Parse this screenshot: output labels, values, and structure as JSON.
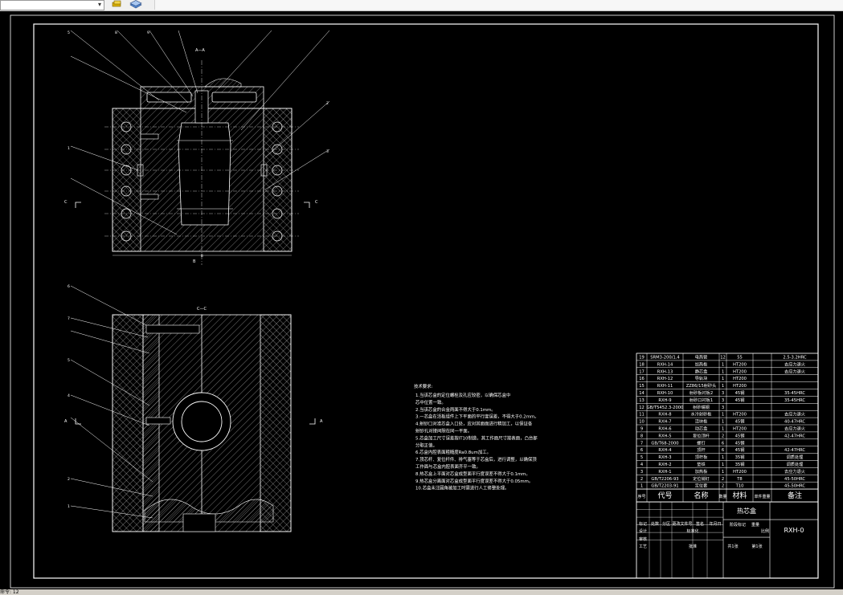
{
  "toolbar": {
    "combo_value": "",
    "icon_1": "layers-yellow-icon",
    "icon_2": "layers-blue-icon"
  },
  "drawing": {
    "section_aa": "A—A",
    "section_cc": "C—C",
    "marker_a": "A",
    "marker_b": "B",
    "marker_c": "C",
    "dim_b": "B",
    "tech_title": "技术要求:",
    "tech_lines": [
      "1.当该芯盒的定位螺栓及孔应较密，以确保芯盒中",
      "芯中位置一致。",
      "2.当该芯盒的合金两面不得大于0.1mm。",
      "3.一芯盒在活板组件上下平面的平行度误差，不得大于0.2mm。",
      "4.射砂口对准芯盒入口处，应对其面面进行精加工，以保证各",
      "射砂孔对接间隙在同一平面。",
      "5.芯盒加工尺寸误差按IT10制造，其工作面尺寸按表面，凸台部",
      "分取正值。",
      "6.芯盒内腔表面粗糙度Ra0.8um加工。",
      "7.顶芯杆、复位杆件、排气塞等于芯盒后，进行调整，以确保顶",
      "工作面与芯盒内腔表面齐平一致。",
      "8.热芯盒上平面对芯盒成型面平行度误差不得大于0.1mm。",
      "9.热芯盒分离面对芯盒成型面平行度误差不得大于0.05mm。",
      "10.芯盒未注圆角被加工时需进行人工修整处理。"
    ],
    "callouts": [
      "5",
      "8",
      "9",
      "1",
      "2",
      "3",
      "4",
      "5",
      "6",
      "7",
      "6",
      "5",
      "4",
      "3",
      "2",
      "1"
    ]
  },
  "bom": {
    "rows": [
      [
        "19",
        "SRM3-200/1.4",
        "电热管",
        "12",
        "55",
        "",
        "2.5-3.2HRC"
      ],
      [
        "18",
        "RXH-14",
        "加热板",
        "1",
        "HT200",
        "",
        "去应力退火"
      ],
      [
        "17",
        "RXH-13",
        "静芯盒",
        "1",
        "HT200",
        "",
        "去应力退火"
      ],
      [
        "16",
        "RXH-12",
        "导轨块",
        "1",
        "HT200",
        "",
        ""
      ],
      [
        "15",
        "RXH-11",
        "ZZ86/15射砂头",
        "1",
        "HT200",
        "",
        ""
      ],
      [
        "14",
        "RXH-10",
        "射砂板衬板2",
        "3",
        "45钢",
        "",
        "35-45HRC"
      ],
      [
        "13",
        "RXH-9",
        "射砂口衬板1",
        "3",
        "45钢",
        "",
        "35-45HRC"
      ],
      [
        "12",
        "GB/T5452.3-2000",
        "射砂嘴钢",
        "3",
        "",
        "",
        ""
      ],
      [
        "11",
        "RXH-8",
        "水冷射砂板",
        "1",
        "HT200",
        "",
        "去应力退火"
      ],
      [
        "10",
        "RXH-7",
        "活块板",
        "1",
        "45钢",
        "",
        "40-47HRC"
      ],
      [
        "9",
        "RXH-6",
        "动芯盒",
        "1",
        "HT200",
        "",
        "去应力退火"
      ],
      [
        "8",
        "RXH-5",
        "复位顶杆",
        "2",
        "45钢",
        "",
        "42-47HRC"
      ],
      [
        "7",
        "GB/T68-2000",
        "螺钉",
        "6",
        "45钢",
        "",
        ""
      ],
      [
        "6",
        "RXH-4",
        "顶杆",
        "6",
        "45钢",
        "",
        "42-47HRC"
      ],
      [
        "5",
        "RXH-3",
        "顶杆板",
        "1",
        "35钢",
        "",
        "调质处理"
      ],
      [
        "4",
        "RXH-2",
        "垫铁",
        "1",
        "35钢",
        "",
        "调质处理"
      ],
      [
        "3",
        "RXH-1",
        "加热板",
        "1",
        "HT200",
        "",
        "去应力退火"
      ],
      [
        "2",
        "GB/T2206-93",
        "定位销钉",
        "2",
        "T8",
        "",
        "45-50HRC"
      ],
      [
        "1",
        "GB/T2203-91",
        "定位套",
        "2",
        "T10",
        "",
        "45-50HRC"
      ]
    ],
    "header": [
      "序号",
      "代号",
      "名称",
      "数量",
      "材料",
      "单件重量",
      "备注"
    ],
    "title_name": "热芯盒",
    "drawing_no": "RXH-0",
    "labels": {
      "marks": "标记",
      "count": "处数",
      "zone": "分区",
      "change_doc": "更改文件号",
      "sign": "签名",
      "date": "年月日",
      "design": "设计",
      "standard": "标准化",
      "stage": "阶段标记",
      "weight": "重量",
      "scale": "比例",
      "check": "审核",
      "process": "工艺",
      "approve": "批准",
      "total": "共1张",
      "sheet": "第1张"
    }
  },
  "status": {
    "text": "命令: 12"
  }
}
